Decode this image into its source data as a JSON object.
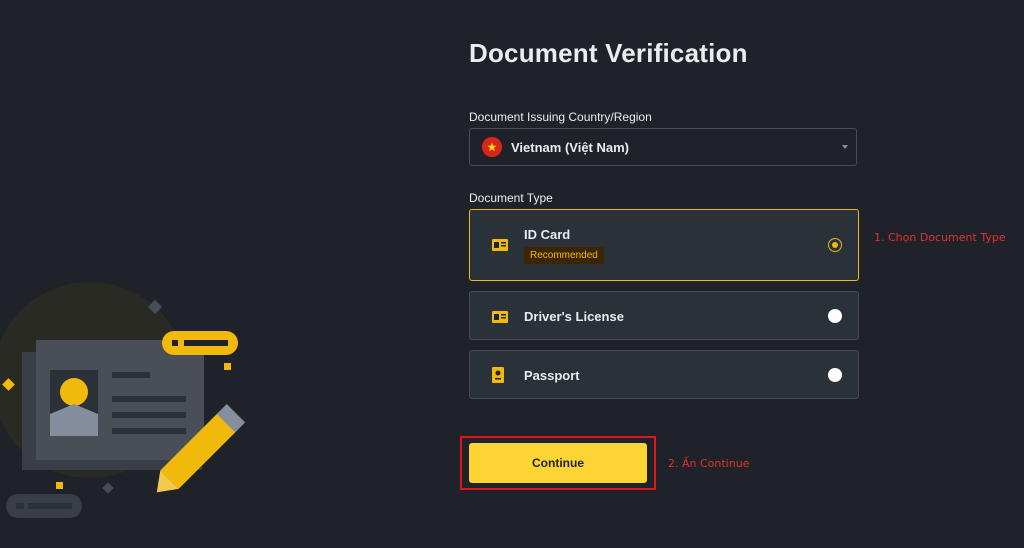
{
  "page": {
    "title": "Document Verification"
  },
  "country": {
    "label": "Document Issuing Country/Region",
    "selected": "Vietnam (Việt Nam)",
    "flag_icon": "vietnam-flag-icon"
  },
  "document_type": {
    "label": "Document Type",
    "options": [
      {
        "label": "ID Card",
        "badge": "Recommended",
        "icon": "id-card-icon",
        "selected": true
      },
      {
        "label": "Driver's License",
        "icon": "drivers-license-icon",
        "selected": false
      },
      {
        "label": "Passport",
        "icon": "passport-icon",
        "selected": false
      }
    ]
  },
  "actions": {
    "continue_label": "Continue"
  },
  "annotations": {
    "step1": "1. Chọn Document Type",
    "step2": "2. Ấn Continue"
  },
  "colors": {
    "background": "#1f2329",
    "accent": "#f0b90b",
    "button": "#fcd535",
    "annotation": "#e03131"
  }
}
